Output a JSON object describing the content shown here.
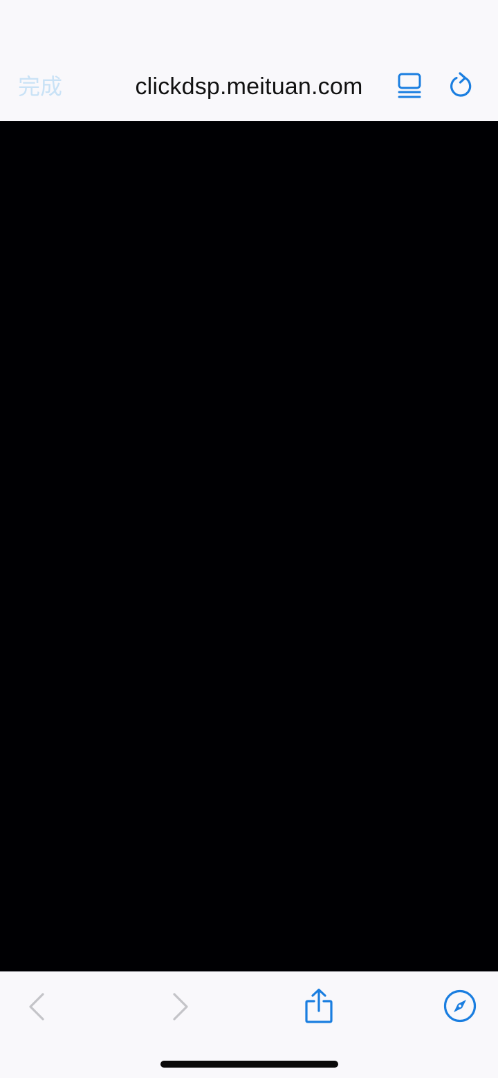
{
  "header": {
    "done_label": "完成",
    "url": "clickdsp.meituan.com",
    "reader_icon": "reader-mode-icon",
    "reload_icon": "reload-icon"
  },
  "toolbar": {
    "back_icon": "chevron-left-icon",
    "forward_icon": "chevron-right-icon",
    "share_icon": "share-icon",
    "safari_icon": "compass-icon"
  },
  "colors": {
    "accent": "#1a7ee0",
    "done_disabled": "#c9e2f6",
    "nav_disabled": "#c4c4c8",
    "content_bg": "#000003",
    "bar_bg": "#f9f8fb"
  }
}
